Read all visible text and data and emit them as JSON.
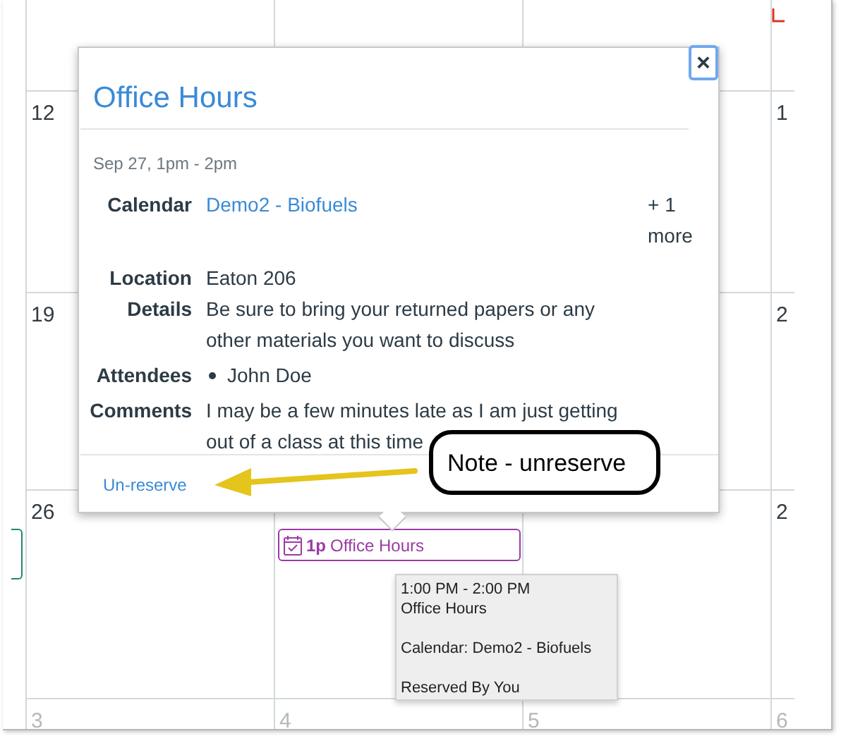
{
  "calendar": {
    "weeks": [
      {
        "cells": {
          "column_1": "12",
          "column_4": "1"
        }
      },
      {
        "cells": {
          "column_1": "19",
          "column_4": "2"
        }
      },
      {
        "cells": {
          "column_1": "26",
          "column_4": "2"
        }
      },
      {
        "cells": {
          "column_1": "3",
          "column_2": "4",
          "column_3": "5",
          "column_4": "6"
        },
        "other_month": true
      }
    ],
    "event": {
      "time": "1p",
      "title": "Office Hours"
    }
  },
  "popover": {
    "title": "Office Hours",
    "close": "×",
    "date": "Sep 27, 1pm - 2pm",
    "fields": [
      {
        "label": "Calendar",
        "kind": "link",
        "value": "Demo2 - Biofuels",
        "extra": "+ 1 more"
      },
      {
        "label": "Location",
        "kind": "text",
        "value": "Eaton 206"
      },
      {
        "label": "Details",
        "kind": "text",
        "value": "Be sure to bring your returned papers or any other materials you want to discuss"
      },
      {
        "label": "Attendees",
        "kind": "list",
        "items": [
          "John Doe"
        ]
      },
      {
        "label": "Comments",
        "kind": "text",
        "value": "I may be a few minutes late as I am just getting out of a class at this time"
      }
    ],
    "action": "Un-reserve"
  },
  "tooltip": {
    "lines": [
      "1:00 PM - 2:00 PM",
      "Office Hours",
      "Calendar: Demo2 - Biofuels",
      "Reserved By You"
    ]
  },
  "note": "Note - unreserve"
}
